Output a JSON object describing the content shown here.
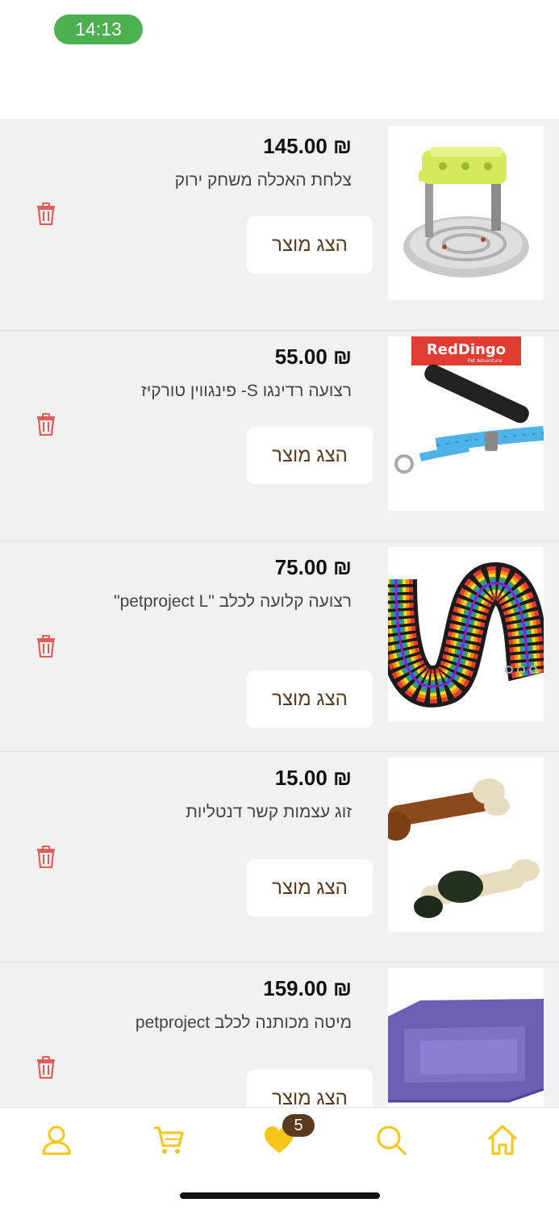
{
  "status_bar": {
    "time": "14:13"
  },
  "currency": "₪",
  "colors": {
    "accent": "#f5c518",
    "status_green": "#4caf50",
    "button_text": "#5a3a1e",
    "trash": "#e35b5b"
  },
  "favorites": [
    {
      "price": "₪ 145.00",
      "name": "צלחת האכלה משחק ירוק",
      "button": "הצג מוצר",
      "image": "green-puzzle-feeder"
    },
    {
      "price": "₪ 55.00",
      "name": "רצועה רדינגו S- פינגווין טורקיז",
      "button": "הצג מוצר",
      "image": "reddingo-leash",
      "image_brand_text": "RedDingo",
      "image_brand_sub": "Pet Adventure"
    },
    {
      "price": "₪ 75.00",
      "name": "רצועה קלועה לכלב \"petproject L\"",
      "button": "הצג מוצר",
      "image": "braided-leashes"
    },
    {
      "price": "₪ 15.00",
      "name": "זוג עצמות קשר דנטליות",
      "button": "הצג מוצר",
      "image": "dental-bones"
    },
    {
      "price": "₪ 159.00",
      "name": "מיטה מכותנה לכלב petproject",
      "button": "הצג מוצר",
      "image": "purple-dog-bed"
    }
  ],
  "bottom_nav": {
    "items": [
      "profile-icon",
      "cart-icon",
      "heart-icon",
      "search-icon",
      "home-icon"
    ],
    "favorites_badge": "5"
  }
}
